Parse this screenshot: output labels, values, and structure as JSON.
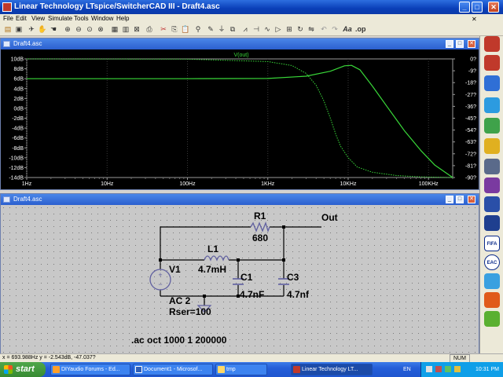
{
  "app": {
    "title": "Linear Technology LTspice/SwitcherCAD III - Draft4.asc",
    "window_buttons": [
      "_",
      "□",
      "✕"
    ]
  },
  "menu": [
    "File",
    "Edit",
    "View",
    "Simulate",
    "Tools",
    "Window",
    "Help"
  ],
  "toolbar_icons": [
    "open-icon",
    "save-icon",
    "run-icon",
    "halt-icon",
    "hand-icon",
    "zoom-in-icon",
    "zoom-out-icon",
    "zoom-fit-icon",
    "autoscale-icon",
    "tile-icon",
    "cascade-icon",
    "close-all-icon",
    "print-icon",
    "cut-icon",
    "copy-icon",
    "paste-icon",
    "find-icon",
    "wire-icon",
    "ground-icon",
    "label-icon",
    "resistor-icon",
    "capacitor-icon",
    "inductor-icon",
    "diode-icon",
    "component-icon",
    "rotate-icon",
    "mirror-icon",
    "undo-icon",
    "redo-icon",
    "text-icon",
    "spice-directive-icon"
  ],
  "plot_window": {
    "title": "Draft4.asc",
    "trace_name": "V(out)",
    "trace_color": "#39d839",
    "phase_color": "#39d839",
    "background": "#000000"
  },
  "chart_data": {
    "type": "line",
    "title": "",
    "x_scale": "log",
    "xlim": [
      1,
      200000
    ],
    "x_ticks": [
      "1Hz",
      "10Hz",
      "100Hz",
      "1KHz",
      "10KHz",
      "100KHz"
    ],
    "left_ticks": [
      "10dB",
      "8dB",
      "6dB",
      "4dB",
      "2dB",
      "0dB",
      "-2dB",
      "-4dB",
      "-6dB",
      "-8dB",
      "-10dB",
      "-12dB",
      "-14dB"
    ],
    "right_ticks": [
      "0?",
      "-9?",
      "-18?",
      "-27?",
      "-36?",
      "-45?",
      "-54?",
      "-63?",
      "-72?",
      "-81?",
      "-90?"
    ],
    "ylim_db": [
      -14,
      10
    ],
    "ylim_phase": [
      -90,
      0
    ],
    "series": [
      {
        "name": "V(out)",
        "axis": "left",
        "style": "solid",
        "x": [
          1,
          10,
          100,
          1000,
          3000,
          6000,
          9000,
          11000,
          14000,
          20000,
          30000,
          50000,
          80000,
          120000,
          200000
        ],
        "y": [
          6.0,
          6.0,
          6.0,
          6.05,
          6.5,
          7.5,
          8.6,
          8.7,
          7.8,
          4.5,
          0.5,
          -4.5,
          -8.5,
          -11.5,
          -14.0
        ]
      },
      {
        "axis": "right",
        "style": "dotted",
        "x": [
          1,
          100,
          1000,
          2000,
          3000,
          4000,
          5000,
          6000,
          7000,
          8000,
          10000,
          13000,
          20000,
          40000,
          80000,
          200000
        ],
        "y": [
          0,
          -0.2,
          -2,
          -5,
          -11,
          -20,
          -32,
          -45,
          -57,
          -66,
          -75,
          -82,
          -86,
          -88.5,
          -89.5,
          -90
        ]
      }
    ]
  },
  "schematic_window": {
    "title": "Draft4.asc",
    "labels": {
      "r1_name": "R1",
      "r1_value": "680",
      "out_label": "Out",
      "l1_name": "L1",
      "l1_value": "4.7mH",
      "v1_name": "V1",
      "c1_name": "C1",
      "c1_value": "4.7nF",
      "c3_name": "C3",
      "c3_value": "4.7nf",
      "source_ac": "AC 2",
      "source_rser": "Rser=100",
      "directive": ".ac oct 1000 1 200000"
    },
    "wire_color": "#000000",
    "component_color": "#6060a0",
    "background": "#c8c8c8"
  },
  "status": {
    "coords": "x = 693.988Hz   y = -2.543dB, -47.037?",
    "num": "NUM"
  },
  "sidebar_icons": [
    "desktop-app-icon-1",
    "desktop-app-icon-2",
    "desktop-app-icon-3",
    "desktop-app-icon-4",
    "desktop-app-icon-5",
    "desktop-app-icon-6",
    "desktop-app-icon-7",
    "desktop-app-icon-8",
    "desktop-app-icon-9",
    "desktop-app-icon-10",
    "fifa-icon",
    "eac-icon",
    "desktop-app-icon-13",
    "desktop-app-icon-14",
    "desktop-app-icon-15"
  ],
  "taskbar": {
    "start_label": "start",
    "tasks": [
      {
        "label": "DIYaudio Forums - Ed...",
        "active": false
      },
      {
        "label": "Document1 - Microsof...",
        "active": false
      },
      {
        "label": "tmp",
        "active": false
      },
      {
        "label": "Linear Technology LT...",
        "active": true
      }
    ],
    "language": "EN",
    "clock": "10:31 PM"
  }
}
